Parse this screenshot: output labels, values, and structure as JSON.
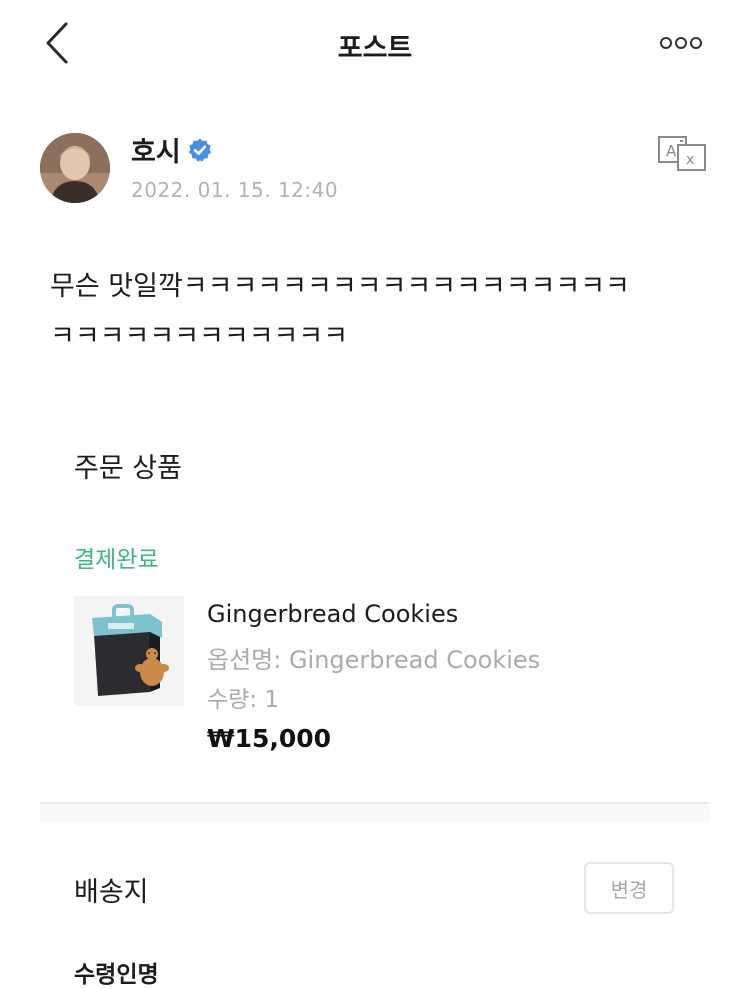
{
  "header": {
    "title": "포스트",
    "back_icon": "chevron-left-icon",
    "more_icon": "more-options-icon"
  },
  "post": {
    "author": "호시",
    "verified_icon": "verified-badge-icon",
    "timestamp": "2022. 01. 15. 12:40",
    "translate_icon": "translate-icon",
    "body": "무슨 맛일깍ㅋㅋㅋㅋㅋㅋㅋㅋㅋㅋㅋㅋㅋㅋㅋㅋㅋㅋ\nㅋㅋㅋㅋㅋㅋㅋㅋㅋㅋㅋㅋ"
  },
  "order": {
    "section_title": "주문 상품",
    "status": "결제완료",
    "status_color": "#3fb57f",
    "product": {
      "name": "Gingerbread Cookies",
      "option": "옵션명: Gingerbread Cookies",
      "quantity": "수량: 1",
      "price": "₩15,000"
    }
  },
  "shipping": {
    "section_title": "배송지",
    "change_button": "변경",
    "receiver_label": "수령인명"
  }
}
